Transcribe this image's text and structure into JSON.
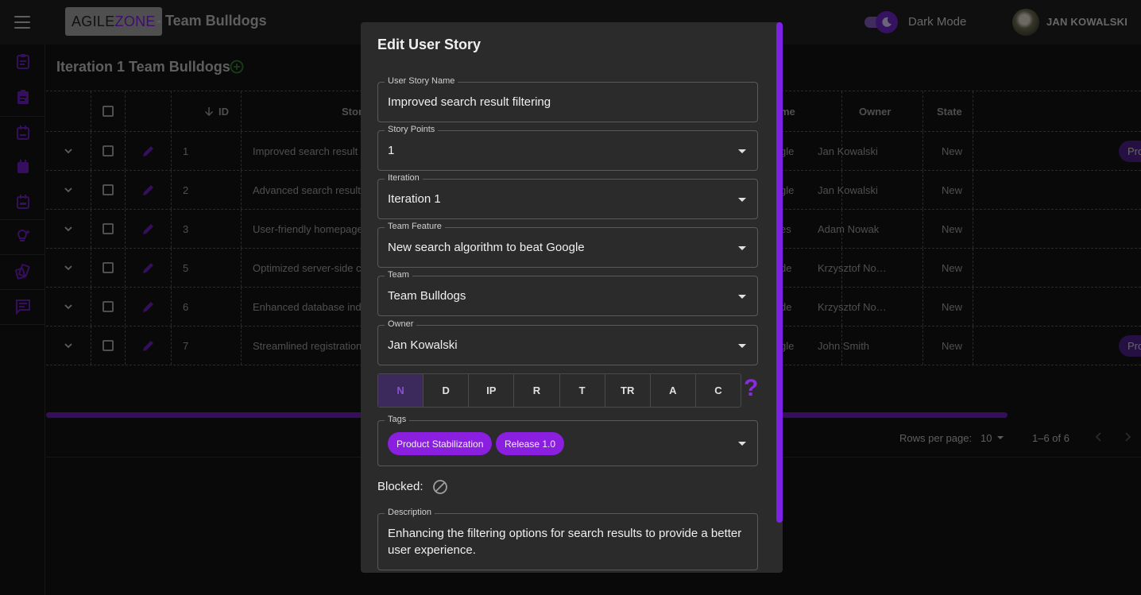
{
  "header": {
    "logo_part1": "AGILE",
    "logo_part2": "ZONE",
    "title": "- Team Bulldogs",
    "dark_mode_label": "Dark Mode",
    "user_name": "JAN KOWALSKI"
  },
  "page": {
    "title": "Iteration 1 Team Bulldogs"
  },
  "grid": {
    "columns": {
      "id": "ID",
      "story": "Stor",
      "feature": "me",
      "owner": "Owner",
      "state": "State"
    },
    "rows": [
      {
        "id": "1",
        "story": "Improved search result f",
        "feature": "gle",
        "owner": "Jan Kowalski",
        "state": "New",
        "badge": "Pro"
      },
      {
        "id": "2",
        "story": "Advanced search result",
        "feature": "gle",
        "owner": "Jan Kowalski",
        "state": "New",
        "badge": ""
      },
      {
        "id": "3",
        "story": "User-friendly homepage",
        "feature": "es",
        "owner": "Adam Nowak",
        "state": "New",
        "badge": ""
      },
      {
        "id": "5",
        "story": "Optimized server-side ca",
        "feature": "de",
        "owner": "Krzysztof No…",
        "state": "New",
        "badge": ""
      },
      {
        "id": "6",
        "story": "Enhanced database inde",
        "feature": "de",
        "owner": "Krzysztof No…",
        "state": "New",
        "badge": ""
      },
      {
        "id": "7",
        "story": "Streamlined registration",
        "feature": "gle",
        "owner": "John Smith",
        "state": "New",
        "badge": "Pro"
      }
    ],
    "pagination": {
      "rows_per_page_label": "Rows per page:",
      "rows_per_page_value": "10",
      "range": "1–6 of 6"
    }
  },
  "dialog": {
    "title": "Edit User Story",
    "fields": {
      "name": {
        "label": "User Story Name",
        "value": "Improved search result filtering"
      },
      "points": {
        "label": "Story Points",
        "value": "1"
      },
      "iteration": {
        "label": "Iteration",
        "value": "Iteration 1"
      },
      "feature": {
        "label": "Team Feature",
        "value": "New search algorithm to beat Google"
      },
      "team": {
        "label": "Team",
        "value": "Team Bulldogs"
      },
      "owner": {
        "label": "Owner",
        "value": "Jan Kowalski"
      }
    },
    "states": [
      "N",
      "D",
      "IP",
      "R",
      "T",
      "TR",
      "A",
      "C"
    ],
    "active_state": "N",
    "help_glyph": "?",
    "tags": {
      "label": "Tags",
      "items": [
        "Product Stabilization",
        "Release 1.0"
      ]
    },
    "blocked_label": "Blocked:",
    "description": {
      "label": "Description",
      "value": "Enhancing the filtering options for search results to provide a better user experience."
    }
  },
  "colors": {
    "accent": "#8a1fe0",
    "background": "#121212",
    "dialog": "#2b2b2b"
  }
}
